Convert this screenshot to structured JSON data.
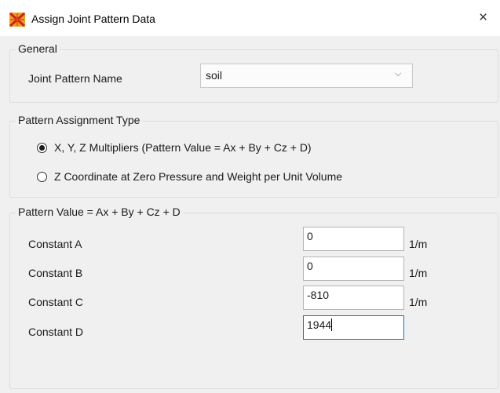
{
  "window": {
    "title": "Assign Joint Pattern Data",
    "close_glyph": "×",
    "app_icon": "sap-app-icon"
  },
  "general": {
    "legend": "General",
    "pattern_name_label": "Joint Pattern Name",
    "pattern_name_value": "soil"
  },
  "assignment_type": {
    "legend": "Pattern Assignment Type",
    "options": [
      {
        "label": "X, Y, Z Multipliers  (Pattern Value = Ax + By + Cz + D)",
        "selected": true
      },
      {
        "label": "Z Coordinate at Zero Pressure and Weight per Unit Volume",
        "selected": false
      }
    ]
  },
  "pattern_value": {
    "legend": "Pattern Value = Ax + By + Cz + D",
    "constants": [
      {
        "label": "Constant A",
        "value": "0",
        "unit": "1/m"
      },
      {
        "label": "Constant B",
        "value": "0",
        "unit": "1/m"
      },
      {
        "label": "Constant C",
        "value": "-810",
        "unit": "1/m"
      },
      {
        "label": "Constant D",
        "value": "1944",
        "unit": ""
      }
    ]
  },
  "colors": {
    "focus_border": "#0078d7",
    "icon_orange": "#f0a020",
    "icon_red": "#d02020"
  }
}
